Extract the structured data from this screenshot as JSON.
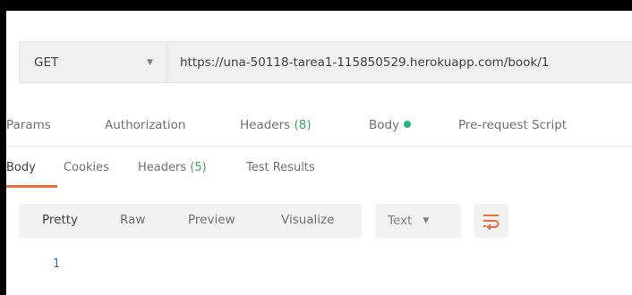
{
  "request": {
    "method": "GET",
    "url": "https://una-50118-tarea1-115850529.herokuapp.com/book/1"
  },
  "request_tabs": {
    "params": "Params",
    "authorization": "Authorization",
    "headers_label": "Headers",
    "headers_count": "(8)",
    "body": "Body",
    "prerequest": "Pre-request Script"
  },
  "response_tabs": {
    "body": "Body",
    "cookies": "Cookies",
    "headers_label": "Headers",
    "headers_count": "(5)",
    "test_results": "Test Results"
  },
  "view": {
    "pretty": "Pretty",
    "raw": "Raw",
    "preview": "Preview",
    "visualize": "Visualize",
    "format": "Text"
  },
  "editor": {
    "line_number": "1"
  },
  "colors": {
    "accent": "#f26b3a",
    "count_green": "#3aa85c",
    "body_dot": "#26b47f",
    "line_number": "#2a6fb0"
  },
  "icons": {
    "method_dropdown": "chevron-down-icon",
    "body_indicator": "dot-icon",
    "format_dropdown": "chevron-down-icon",
    "wrap": "wrap-lines-icon"
  }
}
